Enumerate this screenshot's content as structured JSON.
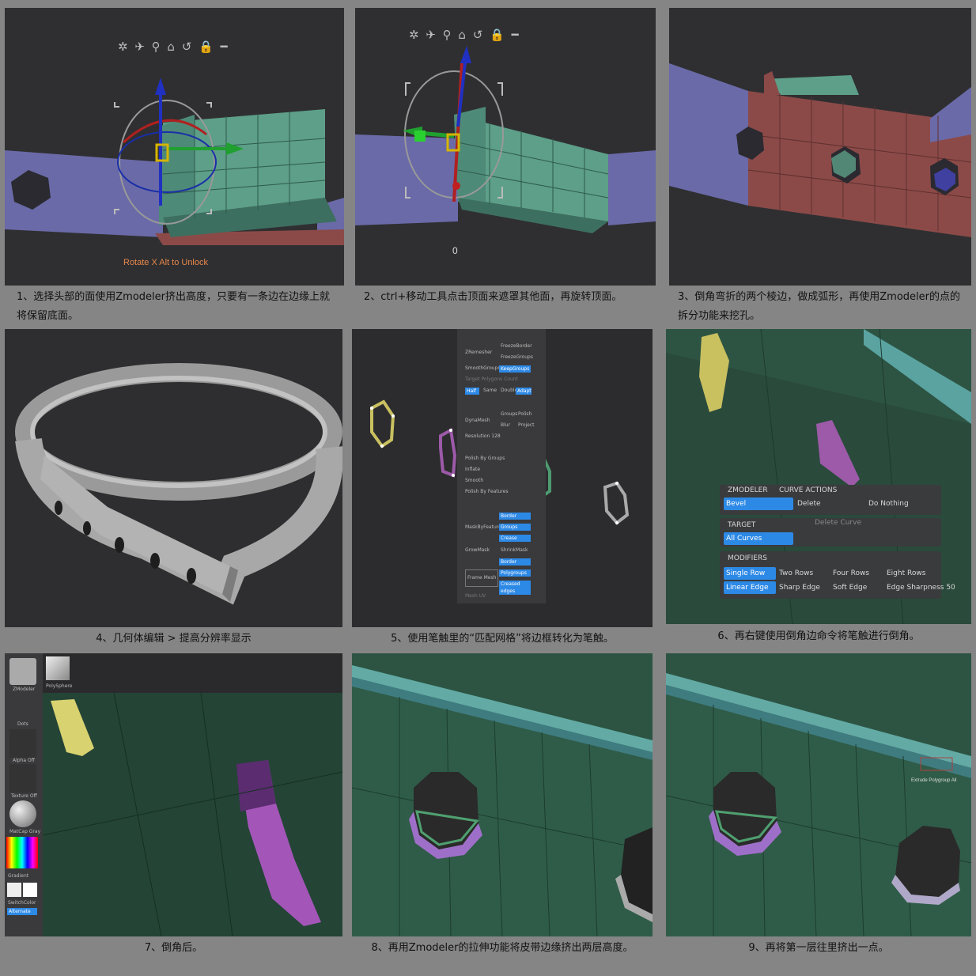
{
  "steps": [
    {
      "caption": "1、选择头部的面使用Zmodeler挤出高度，只要有一条边在边缘上就将保留底面。",
      "overlay": "Rotate X Alt to Unlock"
    },
    {
      "caption": "2、ctrl+移动工具点击顶面来遮罩其他面，再旋转顶面。",
      "overlay": "0"
    },
    {
      "caption": "3、倒角弯折的两个棱边，做成弧形，再使用Zmodeler的点的拆分功能来挖孔。"
    },
    {
      "caption": "4、几何体编辑 > 提高分辨率显示"
    },
    {
      "caption": "5、使用笔触里的“匹配网格”将边框转化为笔触。"
    },
    {
      "caption": "6、再右键使用倒角边命令将笔触进行倒角。"
    },
    {
      "caption": "7、倒角后。"
    },
    {
      "caption": "8、再用Zmodeler的拉伸功能将皮带边缘挤出两层高度。"
    },
    {
      "caption": "9、再将第一层往里挤出一点。",
      "overlay": "Extrude Polygroup All"
    }
  ],
  "gizmo_icons": [
    "gear-icon",
    "pin-icon",
    "location-icon",
    "home-icon",
    "rotate-icon",
    "lock-icon",
    "minus-icon"
  ],
  "gizmo_glyphs": "✲ ✈ ⚲ ⌂ ↺ 🔒 ━",
  "zmodeler_menu": {
    "header_left": "ZMODELER",
    "header_right": "CURVE ACTIONS",
    "bevel": "Bevel",
    "delete": "Delete",
    "do_nothing": "Do Nothing",
    "target": "TARGET",
    "delete_curve": "Delete Curve",
    "all_curves": "All Curves",
    "modifiers": "MODIFIERS",
    "single_row": "Single Row",
    "two_rows": "Two Rows",
    "four_rows": "Four Rows",
    "eight_rows": "Eight Rows",
    "linear_edge": "Linear Edge",
    "sharp_edge": "Sharp Edge",
    "soft_edge": "Soft Edge",
    "edge_sharpness": "Edge Sharpness 50"
  },
  "stroke_panel": {
    "zremesher": "ZRemesher",
    "freeze_border": "FreezeBorder",
    "freeze_groups": "FreezeGroups",
    "smooth_groups": "SmoothGroups",
    "keep_groups": "KeepGroups",
    "target_poly": "Target Polygons Count",
    "half": "Half",
    "same": "Same",
    "double": "Double",
    "adapt": "Adapt",
    "dynamesh": "DynaMesh",
    "groups": "Groups",
    "polish": "Polish",
    "blur": "Blur",
    "project": "Project",
    "resolution": "Resolution 128",
    "polish_groups": "Polish By Groups",
    "inflate": "Inflate",
    "smooth": "Smooth",
    "polish_features": "Polish By Features",
    "border": "Border",
    "mask_by_feature": "MaskByFeature",
    "groups2": "Groups",
    "crease": "Crease",
    "grow_mask": "GrowMask",
    "shrink_mask": "ShrinkMask",
    "frame_mesh": "Frame Mesh",
    "border2": "Border",
    "polygroups": "Polygroups",
    "creased_edges": "Creased edges",
    "mesh_uv": "Mesh UV"
  },
  "side_tray": {
    "zmodeler": "ZModeler",
    "polysphere": "PolySphere",
    "dots": "Dots",
    "alpha_off": "Alpha Off",
    "texture_off": "Texture Off",
    "matcap": "MatCap Gray",
    "gradient": "Gradient",
    "switch_color": "SwitchColor",
    "alternate": "Alternate"
  },
  "colors": {
    "panel_bg": "#2f2f31",
    "page_bg": "#858585",
    "green_face": "#5d9f88",
    "purple_face": "#6a6aa8",
    "red_face": "#8b4a48",
    "zbrush_blue": "#2d89e6"
  }
}
